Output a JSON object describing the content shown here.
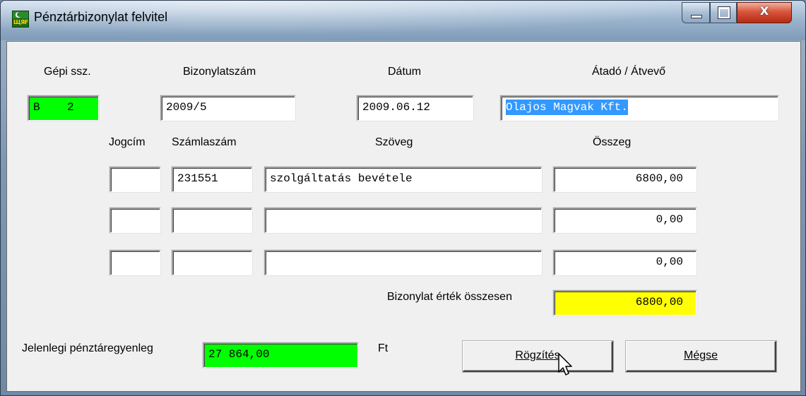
{
  "window": {
    "title": "Pénztárbizonylat felvitel",
    "controls": {
      "minimize": "_",
      "maximize": "□",
      "close": "X"
    },
    "app_icon_text": "ЩЯF"
  },
  "header": {
    "gepi_label": "Gépi ssz.",
    "gepi_value": "B    2",
    "bizonylat_label": "Bizonylatszám",
    "bizonylat_value": "2009/5",
    "datum_label": "Dátum",
    "datum_value": "2009.06.12",
    "atado_label": "Átadó / Átvevő",
    "atado_value": "Olajos Magvak Kft."
  },
  "columns": {
    "jogcim": "Jogcím",
    "szamlaszam": "Számlaszám",
    "szoveg": "Szöveg",
    "osszeg": "Összeg"
  },
  "rows": [
    {
      "jogcim": "",
      "szamlaszam": "231551",
      "szoveg": "szolgáltatás bevétele",
      "osszeg": "6800,00"
    },
    {
      "jogcim": "",
      "szamlaszam": "",
      "szoveg": "",
      "osszeg": "0,00"
    },
    {
      "jogcim": "",
      "szamlaszam": "",
      "szoveg": "",
      "osszeg": "0,00"
    }
  ],
  "total": {
    "label": "Bizonylat érték összesen",
    "value": "6800,00"
  },
  "balance": {
    "label": "Jelenlegi pénztáregyenleg",
    "value": "27 864,00",
    "unit": "Ft"
  },
  "buttons": {
    "save": "Rögzítés",
    "cancel": "Mégse"
  },
  "colors": {
    "green_field": "#00ff00",
    "yellow_field": "#ffff00",
    "selection": "#3399ff"
  }
}
